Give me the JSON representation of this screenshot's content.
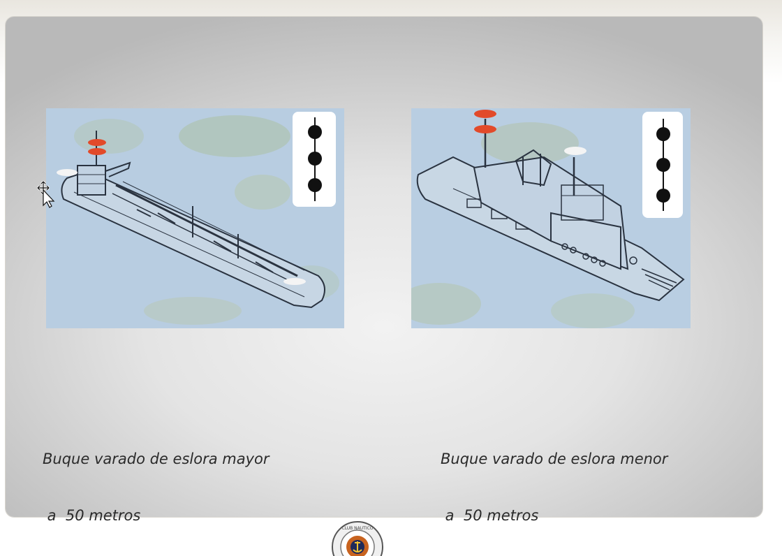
{
  "slide": {
    "left_image": {
      "caption_line1": "Buque varado de eslora mayor",
      "caption_line2": " a  50 metros",
      "vessel": "tanker-ship-illustration",
      "signal_balls": 3
    },
    "right_image": {
      "caption_line1": "Buque varado de eslora menor",
      "caption_line2": " a  50 metros",
      "vessel": "patrol-boat-illustration",
      "signal_balls": 3
    }
  },
  "footer": {
    "logo_text": "CLUB NAUTICO"
  },
  "colors": {
    "panel_bg": "#b9cde0",
    "red_light": "#e24a2a",
    "white_light": "#f4f4f4",
    "ball": "#111111"
  },
  "icons": [
    "move-cursor-icon"
  ]
}
